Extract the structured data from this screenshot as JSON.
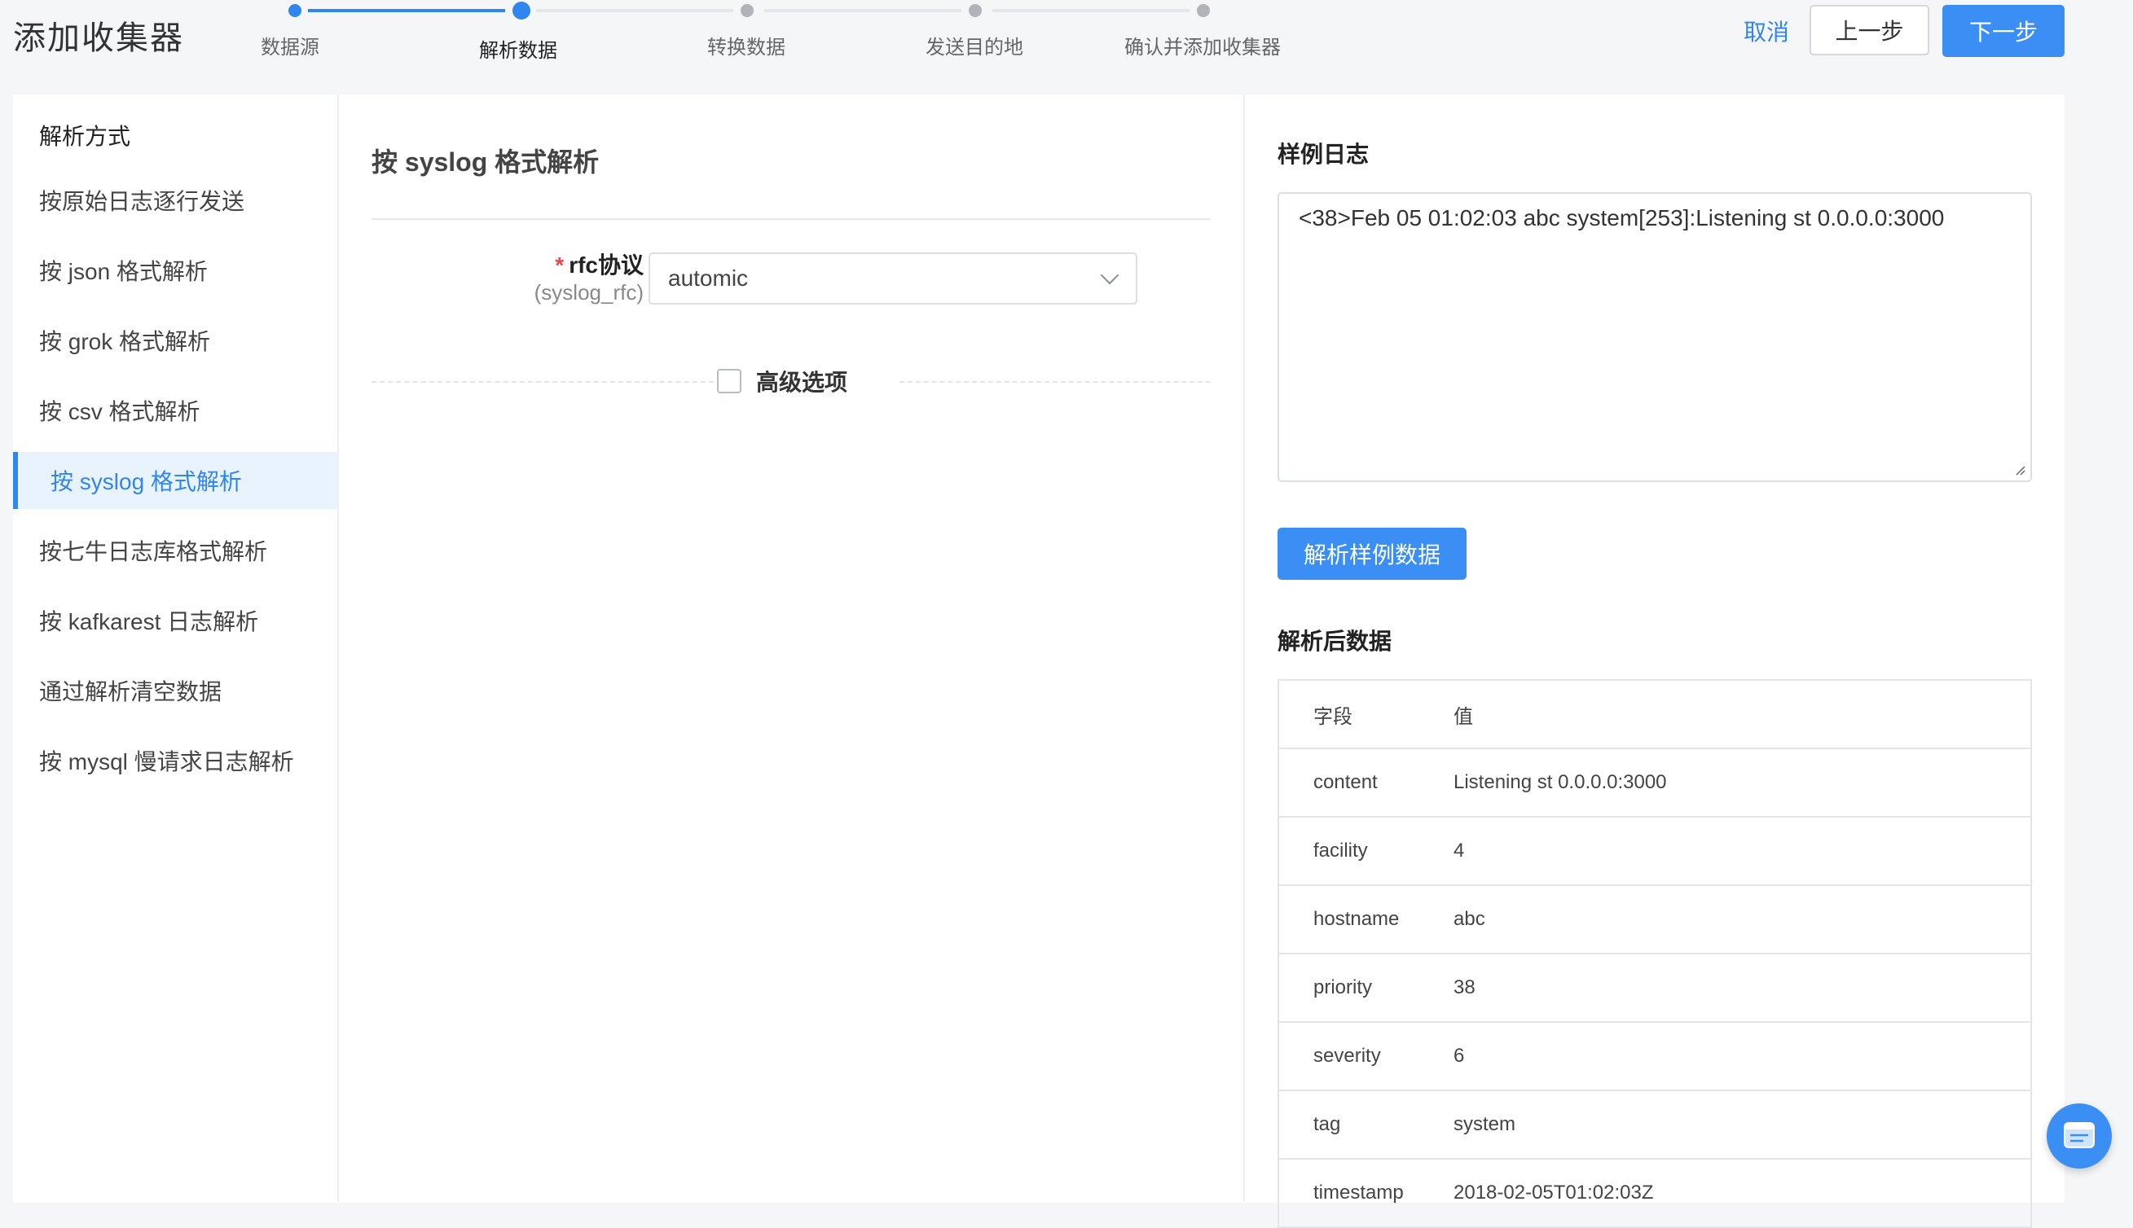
{
  "header": {
    "title": "添加收集器",
    "cancel_label": "取消",
    "prev_label": "上一步",
    "next_label": "下一步"
  },
  "steps": [
    {
      "label": "数据源",
      "state": "done"
    },
    {
      "label": "解析数据",
      "state": "current"
    },
    {
      "label": "转换数据",
      "state": "todo"
    },
    {
      "label": "发送目的地",
      "state": "todo"
    },
    {
      "label": "确认并添加收集器",
      "state": "todo"
    }
  ],
  "sidebar": {
    "heading": "解析方式",
    "items": [
      {
        "label": "按原始日志逐行发送"
      },
      {
        "label": "按 json 格式解析"
      },
      {
        "label": "按 grok 格式解析"
      },
      {
        "label": "按 csv 格式解析"
      },
      {
        "label": "按 syslog 格式解析",
        "active": true
      },
      {
        "label": "按七牛日志库格式解析"
      },
      {
        "label": "按 kafkarest 日志解析"
      },
      {
        "label": "通过解析清空数据"
      },
      {
        "label": "按 mysql 慢请求日志解析"
      }
    ]
  },
  "form": {
    "section_title": "按 syslog 格式解析",
    "required_mark": "*",
    "rfc_label": "rfc协议",
    "rfc_key": "(syslog_rfc)",
    "rfc_value": "automic",
    "advanced_label": "高级选项"
  },
  "sample": {
    "title": "样例日志",
    "text": "<38>Feb 05 01:02:03 abc system[253]:Listening st 0.0.0.0:3000",
    "parse_button": "解析样例数据"
  },
  "result": {
    "title": "解析后数据",
    "header_field": "字段",
    "header_value": "值",
    "rows": [
      {
        "field": "content",
        "value": "Listening st 0.0.0.0:3000"
      },
      {
        "field": "facility",
        "value": "4"
      },
      {
        "field": "hostname",
        "value": "abc"
      },
      {
        "field": "priority",
        "value": "38"
      },
      {
        "field": "severity",
        "value": "6"
      },
      {
        "field": "tag",
        "value": "system"
      },
      {
        "field": "timestamp",
        "value": "2018-02-05T01:02:03Z"
      }
    ]
  },
  "colors": {
    "accent": "#3b8ff4",
    "active_bg": "#e9f3fe",
    "required": "#e5484d"
  },
  "icons": {
    "fab": "message-icon",
    "select_arrow": "chevron-down-icon"
  }
}
